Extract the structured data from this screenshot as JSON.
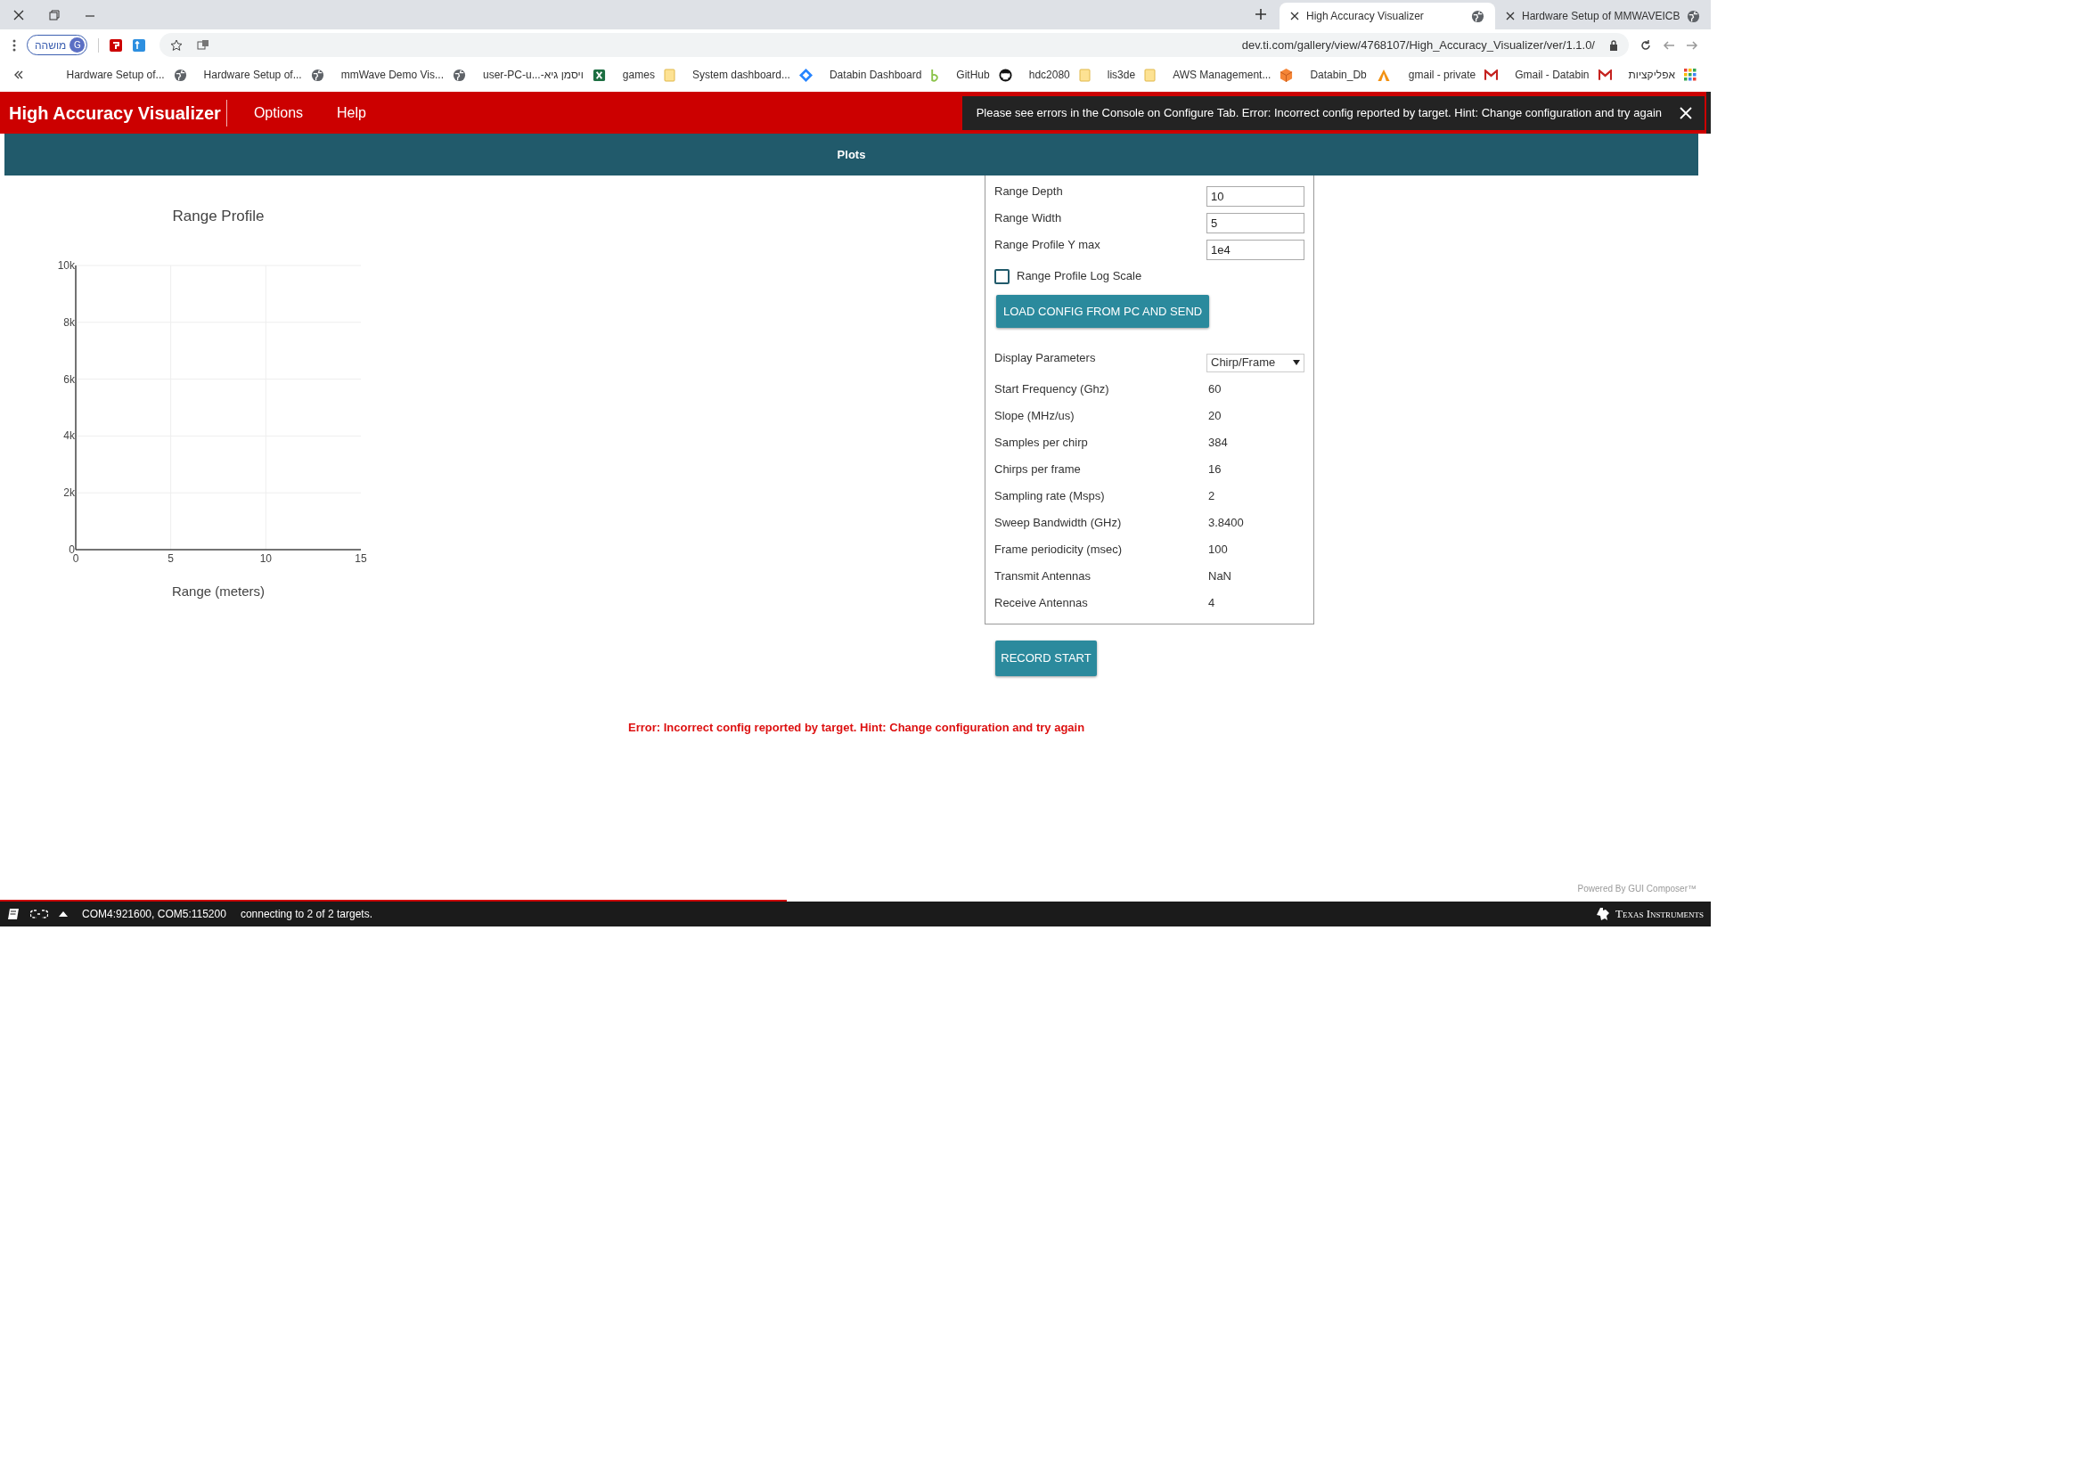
{
  "browser": {
    "tabs": [
      {
        "title": "High Accuracy Visualizer",
        "selected": true
      },
      {
        "title": "Hardware Setup of MMWAVEICB",
        "selected": false
      }
    ],
    "profile": {
      "label": "מושהה",
      "initial": "G"
    },
    "url": "dev.ti.com/gallery/view/4768107/High_Accuracy_Visualizer/ver/1.1.0/",
    "bookmarks": [
      {
        "label": "Hardware Setup of...",
        "kind": "globe"
      },
      {
        "label": "Hardware Setup of...",
        "kind": "globe"
      },
      {
        "label": "mmWave Demo Vis...",
        "kind": "globe"
      },
      {
        "label": "user-PC-u...-ויסמן גיא",
        "kind": "excel"
      },
      {
        "label": "games",
        "kind": "folder"
      },
      {
        "label": "System dashboard...",
        "kind": "diamond"
      },
      {
        "label": "Databin Dashboard",
        "kind": "leaf"
      },
      {
        "label": "GitHub",
        "kind": "github"
      },
      {
        "label": "hdc2080",
        "kind": "folder"
      },
      {
        "label": "lis3de",
        "kind": "folder"
      },
      {
        "label": "AWS Management...",
        "kind": "cube"
      },
      {
        "label": "Databin_Db",
        "kind": "pma"
      },
      {
        "label": "gmail - private",
        "kind": "gmail"
      },
      {
        "label": "Gmail - Databin",
        "kind": "gmail"
      },
      {
        "label": "אפליקציות",
        "kind": "apps"
      }
    ]
  },
  "app": {
    "title": "High Accuracy Visualizer",
    "menu": [
      "Options",
      "Help"
    ],
    "toast": "Please see errors in the Console on Configure Tab. Error: Incorrect config reported by target. Hint: Change configuration and try again",
    "tab": "Plots"
  },
  "chart": {
    "chart_data": {
      "type": "line",
      "grid": true,
      "title": "Range Profile",
      "xlabel": "Range (meters)",
      "xlim": [
        0,
        15
      ],
      "ylim": [
        0,
        10000
      ],
      "xticks": [
        0,
        5,
        10,
        15
      ],
      "yticks": [
        {
          "value": 0,
          "label": "0"
        },
        {
          "value": 2000,
          "label": "2k"
        },
        {
          "value": 4000,
          "label": "4k"
        },
        {
          "value": 6000,
          "label": "6k"
        },
        {
          "value": 8000,
          "label": "8k"
        },
        {
          "value": 10000,
          "label": "10k"
        }
      ]
    }
  },
  "settings": {
    "inputs": [
      {
        "label": "Range Depth",
        "value": "10"
      },
      {
        "label": "Range Width",
        "value": "5"
      },
      {
        "label": "Range Profile Y max",
        "value": "1e4"
      }
    ],
    "log_scale": {
      "label": "Range Profile Log Scale",
      "checked": false
    },
    "load_button": "LOAD CONFIG FROM PC AND SEND",
    "display": {
      "label": "Display Parameters",
      "value": "Chirp/Frame"
    },
    "params": [
      {
        "label": "Start Frequency (Ghz)",
        "value": "60"
      },
      {
        "label": "Slope (MHz/us)",
        "value": "20"
      },
      {
        "label": "Samples per chirp",
        "value": "384"
      },
      {
        "label": "Chirps per frame",
        "value": "16"
      },
      {
        "label": "Sampling rate (Msps)",
        "value": "2"
      },
      {
        "label": "Sweep Bandwidth (GHz)",
        "value": "3.8400"
      },
      {
        "label": "Frame periodicity (msec)",
        "value": "100"
      },
      {
        "label": "Transmit Antennas",
        "value": "NaN"
      },
      {
        "label": "Receive Antennas",
        "value": "4"
      }
    ]
  },
  "record_button": "RECORD START",
  "error": "Error: Incorrect config reported by target. Hint: Change configuration and try again",
  "powered_by": "Powered By GUI Composer™",
  "status_bar": {
    "progress": {
      "level": 0.46
    },
    "ports": "COM4:921600, COM5:115200",
    "status": "connecting to 2 of 2 targets.",
    "brand": "Texas Instruments"
  }
}
